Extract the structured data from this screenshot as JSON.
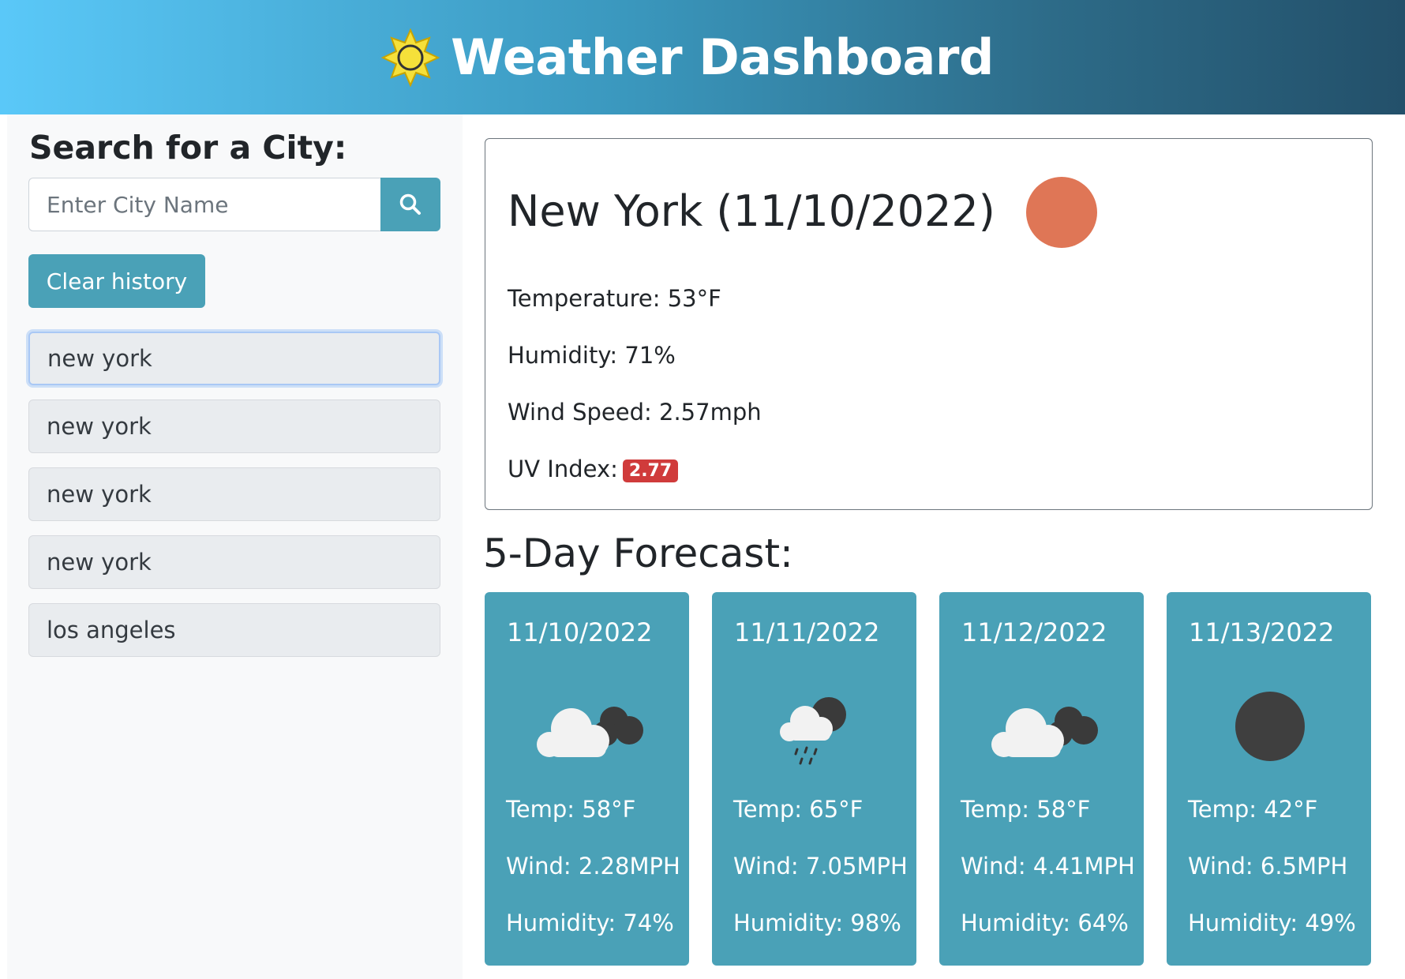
{
  "header": {
    "title": "Weather Dashboard",
    "icon": "sun-icon"
  },
  "sidebar": {
    "heading": "Search for a City:",
    "search_placeholder": "Enter City Name",
    "search_icon": "search-icon",
    "clear_label": "Clear history",
    "history": [
      {
        "label": "new york"
      },
      {
        "label": "new york"
      },
      {
        "label": "new york"
      },
      {
        "label": "new york"
      },
      {
        "label": "los angeles"
      }
    ]
  },
  "current": {
    "title": "New York (11/10/2022)",
    "icon": "clear-sky-icon",
    "temperature": "Temperature: 53°F",
    "humidity": "Humidity: 71%",
    "wind": "Wind Speed: 2.57mph",
    "uv_label": "UV Index:",
    "uv_value": "2.77",
    "uv_color": "#d03b3b"
  },
  "forecast": {
    "title": "5-Day Forecast:",
    "cards": [
      {
        "date": "11/10/2022",
        "icon": "broken-clouds-icon",
        "temp": "Temp: 58°F",
        "wind": "Wind: 2.28MPH",
        "humidity": "Humidity: 74%"
      },
      {
        "date": "11/11/2022",
        "icon": "rain-icon",
        "temp": "Temp: 65°F",
        "wind": "Wind: 7.05MPH",
        "humidity": "Humidity: 98%"
      },
      {
        "date": "11/12/2022",
        "icon": "broken-clouds-icon",
        "temp": "Temp: 58°F",
        "wind": "Wind: 4.41MPH",
        "humidity": "Humidity: 64%"
      },
      {
        "date": "11/13/2022",
        "icon": "clear-night-icon",
        "temp": "Temp: 42°F",
        "wind": "Wind: 6.5MPH",
        "humidity": "Humidity: 49%"
      }
    ]
  },
  "colors": {
    "accent": "#4aa1b7",
    "current_icon": "#df7656"
  }
}
